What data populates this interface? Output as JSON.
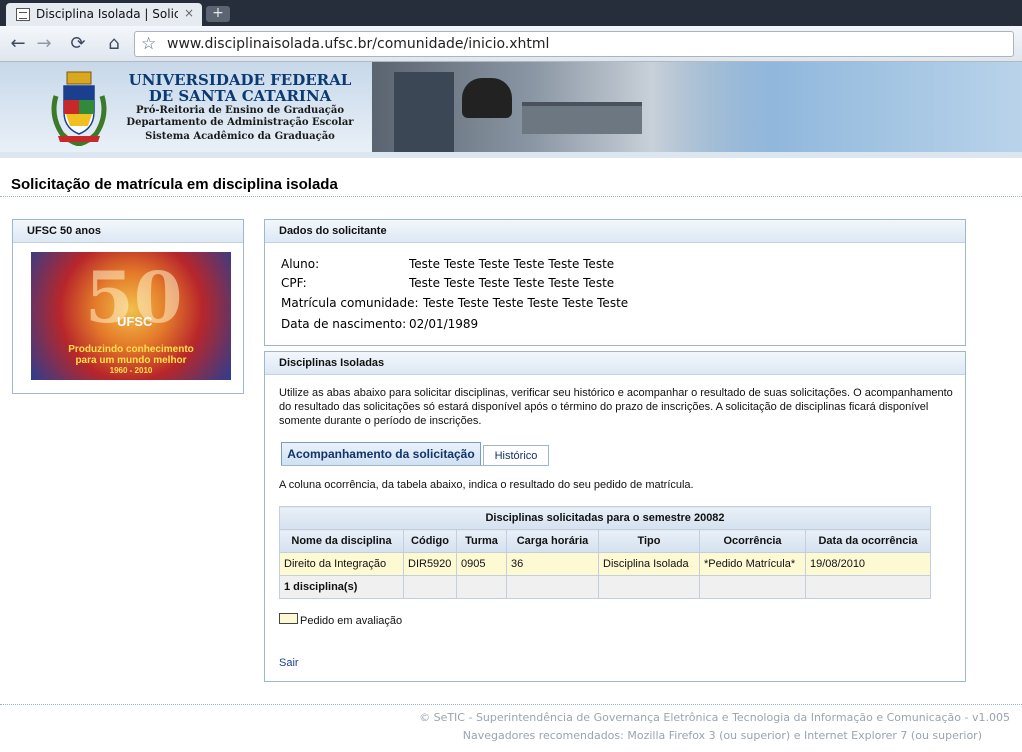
{
  "browser": {
    "tab_title": "Disciplina Isolada | Solicit...",
    "tab_close": "×",
    "new_tab": "+",
    "url": "www.disciplinaisolada.ufsc.br/comunidade/inicio.xhtml",
    "icons": {
      "back": "←",
      "forward": "→",
      "reload": "⟳",
      "home": "⌂",
      "star": "☆"
    }
  },
  "banner": {
    "title_line1": "UNIVERSIDADE FEDERAL",
    "title_line2": "DE SANTA CATARINA",
    "line3": "Pró-Reitoria de Ensino de Graduação",
    "line4": "Departamento de Administração Escolar",
    "line5": "Sistema Acadêmico da Graduação"
  },
  "page": {
    "title": "Solicitação de matrícula em disciplina isolada"
  },
  "sidebar": {
    "panel_title": "UFSC 50 anos",
    "image": {
      "number": "50",
      "logo_text": "UFSC",
      "slogan1": "Produzindo conhecimento",
      "slogan2": "para um mundo melhor",
      "years": "1960 - 2010"
    }
  },
  "applicant": {
    "panel_title": "Dados do solicitante",
    "fields": [
      {
        "label": "Aluno:",
        "value": "Teste Teste Teste Teste Teste Teste"
      },
      {
        "label": "CPF:",
        "value": "Teste Teste Teste Teste Teste Teste"
      },
      {
        "label": "Matrícula comunidade:",
        "value": "Teste Teste Teste Teste Teste Teste"
      },
      {
        "label": "Data de nascimento:",
        "value": "02/01/1989"
      }
    ]
  },
  "disciplinas": {
    "panel_title": "Disciplinas Isoladas",
    "intro": "Utilize as abas abaixo para solicitar disciplinas, verificar seu histórico e acompanhar o resultado de suas solicitações. O acompanhamento do resultado das solicitações só estará disponível após o término do prazo de inscrições. A solicitação de disciplinas ficará disponível somente durante o período de inscrições.",
    "tabs": [
      {
        "label": "Acompanhamento da solicitação",
        "active": true
      },
      {
        "label": "Histórico",
        "active": false
      }
    ],
    "note": "A coluna ocorrência, da tabela abaixo, indica o resultado do seu pedido de matrícula.",
    "table": {
      "caption": "Disciplinas solicitadas para o semestre 20082",
      "columns": [
        "Nome da disciplina",
        "Código",
        "Turma",
        "Carga horária",
        "Tipo",
        "Ocorrência",
        "Data da ocorrência"
      ],
      "rows": [
        [
          "Direito da Integração",
          "DIR5920",
          "0905",
          "36",
          "Disciplina Isolada",
          "*Pedido Matrícula*",
          "19/08/2010"
        ]
      ],
      "footer": "1 disciplina(s)"
    },
    "legend": "Pedido em avaliação",
    "exit": "Sair"
  },
  "footer": {
    "line1": "© SeTIC - Superintendência de Governança Eletrônica e Tecnologia da Informação e Comunicação - v1.005",
    "line2": "Navegadores recomendados: Mozilla Firefox 3 (ou superior) e Internet Explorer 7 (ou superior)"
  },
  "colors": {
    "highlight_row": "#fdf9d2",
    "panel_border": "#9fb6cf",
    "link": "#1a3f8f"
  }
}
